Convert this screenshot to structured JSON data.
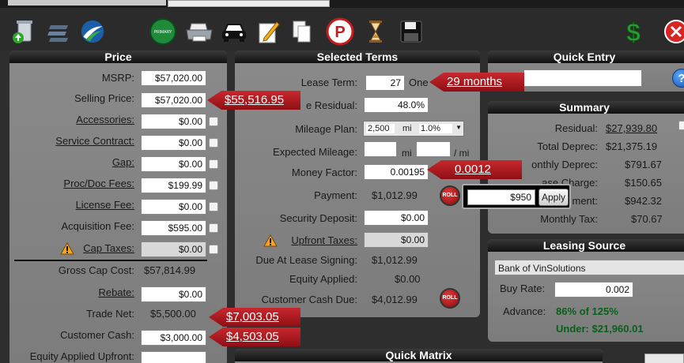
{
  "toolbar": {
    "icons": [
      "trash-recycle-icon",
      "list-icon",
      "vinsolutions-logo-icon",
      "primary-badge-icon",
      "printer-icon",
      "car-icon",
      "edit-pencil-icon",
      "copy-icon",
      "parking-icon",
      "hourglass-icon",
      "save-disk-icon",
      "dollar-icon",
      "close-icon"
    ],
    "primary_badge": "PRIMARY"
  },
  "price": {
    "title": "Price",
    "msrp_label": "MSRP:",
    "msrp": "$57,020.00",
    "selling_price_label": "Selling Price:",
    "selling_price": "$57,020.00",
    "selling_price_flag": "$55,516.95",
    "accessories_label": "Accessories:",
    "accessories": "$0.00",
    "service_contract_label": "Service Contract:",
    "service_contract": "$0.00",
    "gap_label": "Gap:",
    "gap": "$0.00",
    "proc_doc_fees_label": "Proc/Doc Fees:",
    "proc_doc_fees": "$199.99",
    "license_fee_label": "License Fee:",
    "license_fee": "$0.00",
    "acquisition_fee_label": "Acquisition Fee:",
    "acquisition_fee": "$595.00",
    "cap_taxes_label": "Cap Taxes:",
    "cap_taxes": "$0.00",
    "gross_cap_cost_label": "Gross Cap Cost:",
    "gross_cap_cost": "$57,814.99",
    "rebate_label": "Rebate:",
    "rebate": "$0.00",
    "trade_net_label": "Trade Net:",
    "trade_net": "$5,500.00",
    "trade_net_flag": "$7,003.05",
    "customer_cash_label": "Customer Cash:",
    "customer_cash": "$3,000.00",
    "customer_cash_flag": "$4,503.05",
    "equity_applied_upfront_label": "Equity Applied Upfront:"
  },
  "terms": {
    "title": "Selected Terms",
    "lease_term_label": "Lease Term:",
    "lease_term": "27",
    "lease_term_suffix": "One",
    "lease_term_flag": "29 months",
    "residual_label": "e Residual:",
    "residual": "48.0%",
    "mileage_plan_label": "Mileage Plan:",
    "mileage_plan_miles": "2,500",
    "mileage_plan_unit": "mi",
    "mileage_plan_rate": "1.0%",
    "expected_mileage_label": "Expected Mileage:",
    "expected_mileage_unit": "mi",
    "expected_mileage_per": "/ mi",
    "money_factor_label": "Money Factor:",
    "money_factor": "0.00195",
    "money_factor_flag": "0.0012",
    "payment_label": "Payment:",
    "payment": "$1,012.99",
    "roll_label": "ROLL",
    "security_deposit_label": "Security Deposit:",
    "security_deposit": "$0.00",
    "upfront_taxes_label": "Upfront Taxes:",
    "upfront_taxes": "$0.00",
    "due_at_signing_label": "Due At Lease Signing:",
    "due_at_signing": "$1,012.99",
    "equity_applied_label": "Equity Applied:",
    "equity_applied": "$0.00",
    "customer_cash_due_label": "Customer Cash Due:",
    "customer_cash_due": "$4,012.99"
  },
  "apply_popup": {
    "value": "$950",
    "button": "Apply"
  },
  "quick_entry": {
    "title": "Quick Entry",
    "help": "?"
  },
  "summary": {
    "title": "Summary",
    "residual_label": "Residual:",
    "residual": "$27,939.80",
    "total_deprec_label": "Total Deprec:",
    "total_deprec": "$21,375.19",
    "monthly_deprec_label": "onthly Deprec:",
    "monthly_deprec": "$791.67",
    "lease_charge_label": "ase Charge:",
    "lease_charge": "$150.65",
    "payment_label": "ment:",
    "payment": "$942.32",
    "monthly_tax_label": "Monthly Tax:",
    "monthly_tax": "$70.67"
  },
  "leasing_source": {
    "title": "Leasing Source",
    "bank": "Bank of VinSolutions",
    "buy_rate_label": "Buy Rate:",
    "buy_rate": "0.002",
    "advance_label": "Advance:",
    "advance": "86% of 125%",
    "under": "Under: $21,960.01"
  },
  "quick_matrix": {
    "title": "Quick Matrix"
  },
  "colors": {
    "flag_red": "#b81d22",
    "panel_grey": "#848484",
    "advance_green": "#0b5e1d"
  }
}
